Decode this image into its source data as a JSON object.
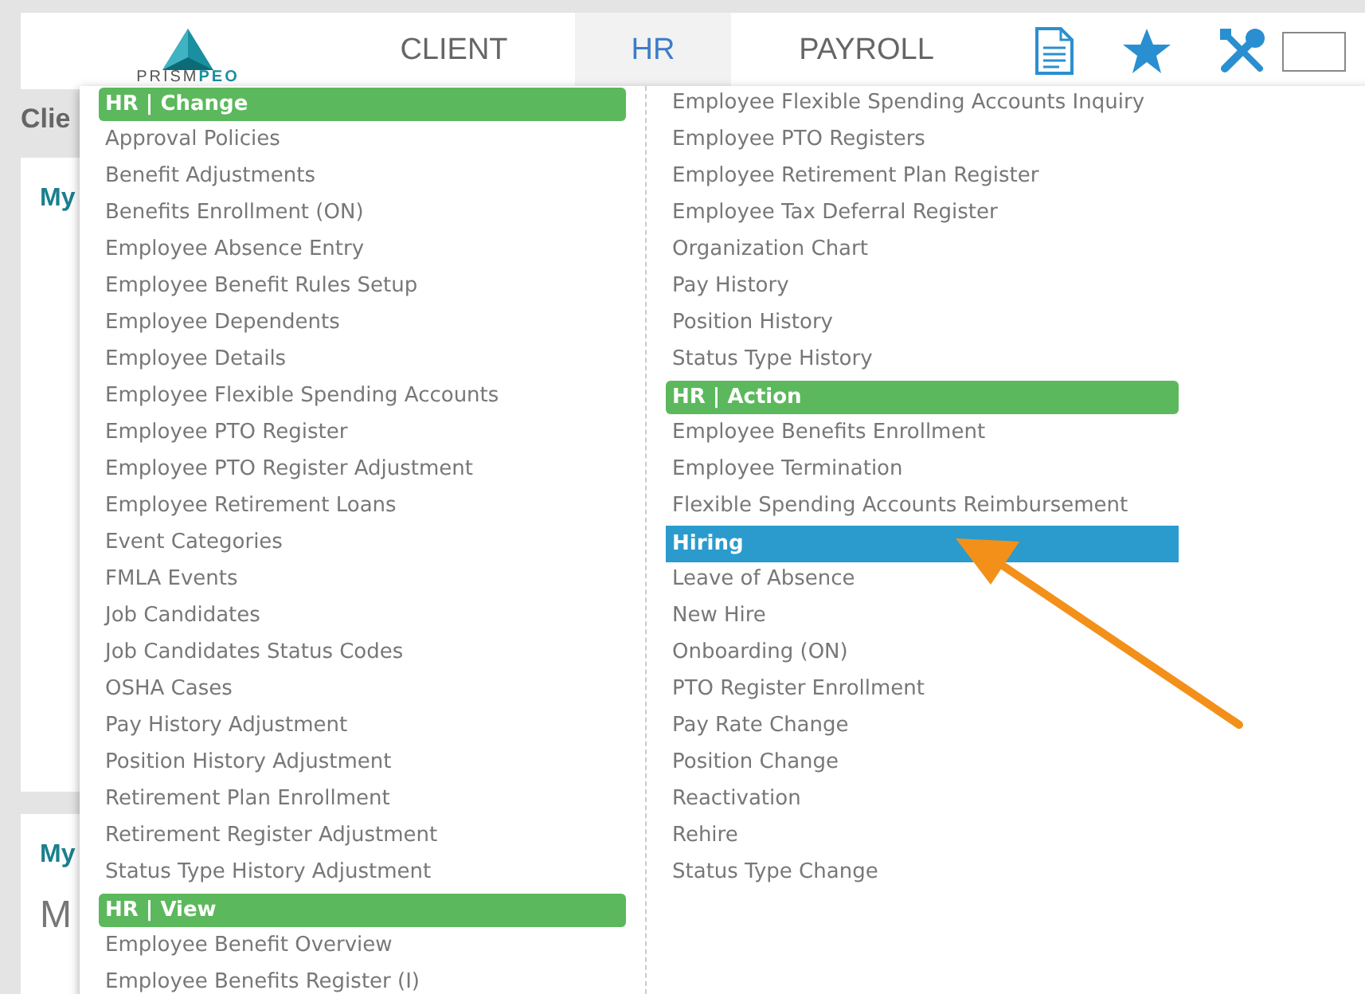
{
  "logo": {
    "name": "PRISM",
    "suffix": "PEO"
  },
  "nav": [
    {
      "label": "CLIENT",
      "selected": false
    },
    {
      "label": "HR",
      "selected": true
    },
    {
      "label": "PAYROLL",
      "selected": false
    }
  ],
  "background": {
    "page_title": "Clie",
    "cards": [
      {
        "title": "My"
      },
      {
        "title": "My",
        "subtitle": "M"
      }
    ]
  },
  "menu": {
    "columns": [
      [
        {
          "kind": "header",
          "label": "HR | Change",
          "selected": false
        },
        {
          "kind": "item",
          "label": "Approval Policies",
          "selected": false
        },
        {
          "kind": "item",
          "label": "Benefit Adjustments",
          "selected": false
        },
        {
          "kind": "item",
          "label": "Benefits Enrollment (ON)",
          "selected": false
        },
        {
          "kind": "item",
          "label": "Employee Absence Entry",
          "selected": false
        },
        {
          "kind": "item",
          "label": "Employee Benefit Rules Setup",
          "selected": false
        },
        {
          "kind": "item",
          "label": "Employee Dependents",
          "selected": false
        },
        {
          "kind": "item",
          "label": "Employee Details",
          "selected": false
        },
        {
          "kind": "item",
          "label": "Employee Flexible Spending Accounts",
          "selected": false
        },
        {
          "kind": "item",
          "label": "Employee PTO Register",
          "selected": false
        },
        {
          "kind": "item",
          "label": "Employee PTO Register Adjustment",
          "selected": false
        },
        {
          "kind": "item",
          "label": "Employee Retirement Loans",
          "selected": false
        },
        {
          "kind": "item",
          "label": "Event Categories",
          "selected": false
        },
        {
          "kind": "item",
          "label": "FMLA Events",
          "selected": false
        },
        {
          "kind": "item",
          "label": "Job Candidates",
          "selected": false
        },
        {
          "kind": "item",
          "label": "Job Candidates Status Codes",
          "selected": false
        },
        {
          "kind": "item",
          "label": "OSHA Cases",
          "selected": false
        },
        {
          "kind": "item",
          "label": "Pay History Adjustment",
          "selected": false
        },
        {
          "kind": "item",
          "label": "Position History Adjustment",
          "selected": false
        },
        {
          "kind": "item",
          "label": "Retirement Plan Enrollment",
          "selected": false
        },
        {
          "kind": "item",
          "label": "Retirement Register Adjustment",
          "selected": false
        },
        {
          "kind": "item",
          "label": "Status Type History Adjustment",
          "selected": false
        },
        {
          "kind": "header",
          "label": "HR | View",
          "selected": false
        },
        {
          "kind": "item",
          "label": "Employee Benefit Overview",
          "selected": false
        },
        {
          "kind": "item",
          "label": "Employee Benefits Register (I)",
          "selected": false
        }
      ],
      [
        {
          "kind": "item",
          "label": "Employee Flexible Spending Accounts Inquiry",
          "selected": false
        },
        {
          "kind": "item",
          "label": "Employee PTO Registers",
          "selected": false
        },
        {
          "kind": "item",
          "label": "Employee Retirement Plan Register",
          "selected": false
        },
        {
          "kind": "item",
          "label": "Employee Tax Deferral Register",
          "selected": false
        },
        {
          "kind": "item",
          "label": "Organization Chart",
          "selected": false
        },
        {
          "kind": "item",
          "label": "Pay History",
          "selected": false
        },
        {
          "kind": "item",
          "label": "Position History",
          "selected": false
        },
        {
          "kind": "item",
          "label": "Status Type History",
          "selected": false
        },
        {
          "kind": "header",
          "label": "HR | Action",
          "selected": false
        },
        {
          "kind": "item",
          "label": "Employee Benefits Enrollment",
          "selected": false
        },
        {
          "kind": "item",
          "label": "Employee Termination",
          "selected": false
        },
        {
          "kind": "item",
          "label": "Flexible Spending Accounts Reimbursement",
          "selected": false
        },
        {
          "kind": "item",
          "label": "Hiring",
          "selected": true
        },
        {
          "kind": "item",
          "label": "Leave of Absence",
          "selected": false
        },
        {
          "kind": "item",
          "label": "New Hire",
          "selected": false
        },
        {
          "kind": "item",
          "label": "Onboarding (ON)",
          "selected": false
        },
        {
          "kind": "item",
          "label": "PTO Register Enrollment",
          "selected": false
        },
        {
          "kind": "item",
          "label": "Pay Rate Change",
          "selected": false
        },
        {
          "kind": "item",
          "label": "Position Change",
          "selected": false
        },
        {
          "kind": "item",
          "label": "Reactivation",
          "selected": false
        },
        {
          "kind": "item",
          "label": "Rehire",
          "selected": false
        },
        {
          "kind": "item",
          "label": "Status Type Change",
          "selected": false
        }
      ]
    ]
  }
}
